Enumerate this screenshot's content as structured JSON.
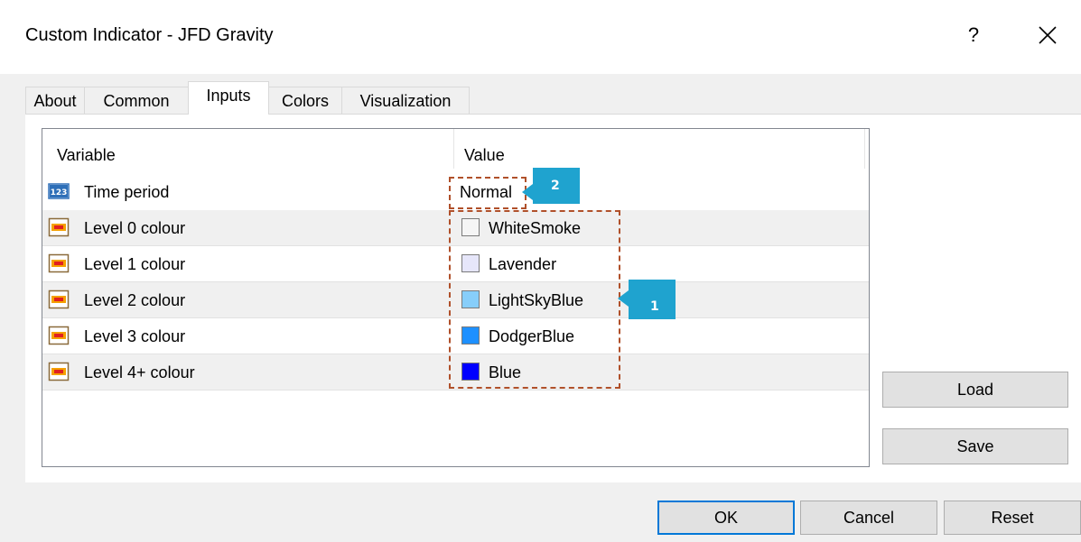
{
  "window": {
    "title": "Custom Indicator - JFD Gravity",
    "help": "?"
  },
  "tabs": [
    "About",
    "Common",
    "Inputs",
    "Colors",
    "Visualization"
  ],
  "active_tab": "Inputs",
  "table": {
    "headers": {
      "variable": "Variable",
      "value": "Value"
    },
    "rows": [
      {
        "icon": "number-input-icon",
        "label": "Time period",
        "value": "Normal"
      },
      {
        "icon": "color-input-icon",
        "label": "Level 0 colour",
        "value": "WhiteSmoke",
        "color": "#f5f5f5"
      },
      {
        "icon": "color-input-icon",
        "label": "Level 1 colour",
        "value": "Lavender",
        "color": "#e6e6fa"
      },
      {
        "icon": "color-input-icon",
        "label": "Level 2 colour",
        "value": "LightSkyBlue",
        "color": "#87cefa"
      },
      {
        "icon": "color-input-icon",
        "label": "Level 3 colour",
        "value": "DodgerBlue",
        "color": "#1e90ff"
      },
      {
        "icon": "color-input-icon",
        "label": "Level 4+ colour",
        "value": "Blue",
        "color": "#0000ff"
      }
    ]
  },
  "annotations": {
    "badge1": "1",
    "badge2": "2"
  },
  "side_buttons": {
    "load": "Load",
    "save": "Save"
  },
  "footer_buttons": {
    "ok": "OK",
    "cancel": "Cancel",
    "reset": "Reset"
  },
  "colors": {
    "annotation_border": "#b0502a",
    "badge": "#1fa3cf",
    "default_button_border": "#0078d7"
  }
}
